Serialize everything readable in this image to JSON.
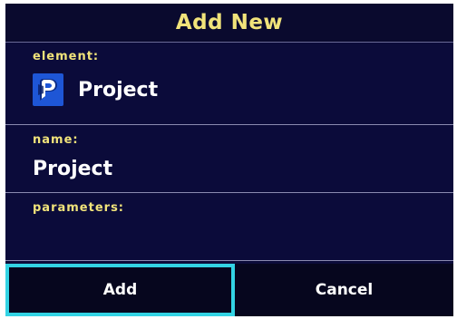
{
  "dialog": {
    "title": "Add New"
  },
  "element": {
    "label": "element:",
    "value": "Project",
    "icon": "project-icon"
  },
  "name": {
    "label": "name:",
    "value": "Project"
  },
  "parameters": {
    "label": "parameters:"
  },
  "buttons": {
    "add_label": "Add",
    "cancel_label": "Cancel"
  },
  "colors": {
    "background": "#0b0b3a",
    "header_text": "#f1e37a",
    "focus_border": "#33d3e4",
    "icon_background": "#1e56d6"
  }
}
